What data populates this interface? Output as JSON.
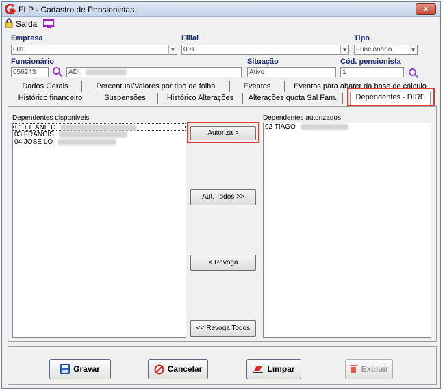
{
  "window": {
    "title": "FLP - Cadastro de Pensionistas",
    "close_label": "x"
  },
  "menu": {
    "exit_label": "Saída"
  },
  "fields": {
    "empresa_label": "Empresa",
    "empresa_value": "001",
    "filial_label": "Filial",
    "filial_value": "001",
    "tipo_label": "Tipo",
    "tipo_value": "Funcionário",
    "funcionario_label": "Funcionário",
    "funcionario_code": "056243",
    "funcionario_name": "ADI",
    "situacao_label": "Situação",
    "situacao_value": "Ativo",
    "cod_pensionista_label": "Cód. pensionista",
    "cod_pensionista_value": "1"
  },
  "tabs_row1": [
    {
      "label": "Dados Gerais"
    },
    {
      "label": "Percentual/Valores por tipo de folha"
    },
    {
      "label": "Eventos"
    },
    {
      "label": "Eventos para abater da base de cálculo"
    }
  ],
  "tabs_row2": [
    {
      "label": "Histórico financeiro"
    },
    {
      "label": "Suspensões"
    },
    {
      "label": "Histórico Alterações"
    },
    {
      "label": "Alterações quota Sal Fam."
    },
    {
      "label": "Dependentes - DIRF"
    }
  ],
  "lists": {
    "available_label": "Dependentes disponíveis",
    "available_items": [
      "01 ELIANE D",
      "03 FRANCIS",
      "04 JOSE LO"
    ],
    "authorized_label": "Dependentes autorizados",
    "authorized_items": [
      "02 TIAGO"
    ]
  },
  "actions": {
    "authorize": "Autoriza >",
    "authorize_all": "Aut. Todos >>",
    "revoke": "< Revoga",
    "revoke_all": "<< Revoga Todos"
  },
  "bottom": {
    "save": "Gravar",
    "cancel": "Cancelar",
    "clear": "Limpar",
    "delete": "Excluir"
  },
  "colors": {
    "highlight": "#e23b2e",
    "label_blue": "#1b2a7a"
  }
}
